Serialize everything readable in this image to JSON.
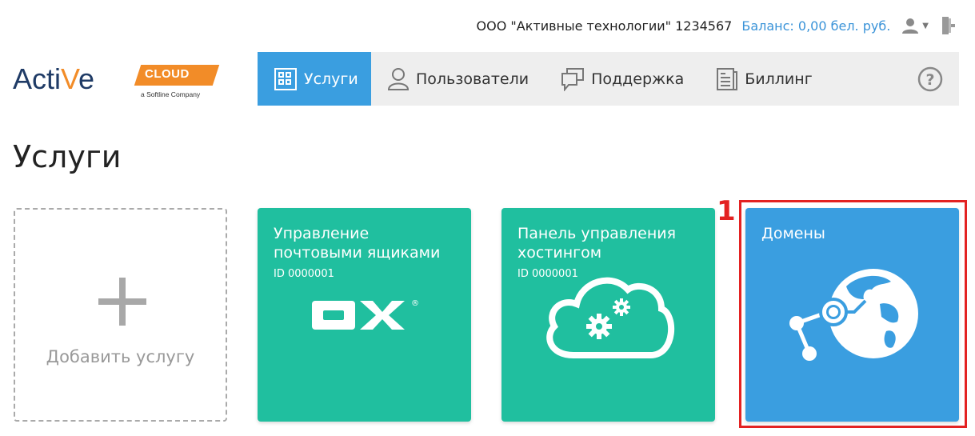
{
  "header": {
    "company": "ООО \"Активные технологии\" 1234567",
    "balance": "Баланс: 0,00 бел. руб.",
    "user_icon": "user-icon",
    "logout_icon": "logout-icon"
  },
  "logo": {
    "word": "ActiVe",
    "badge": "CLOUD",
    "subtitle": "a Softline Company"
  },
  "nav": {
    "items": [
      {
        "label": "Услуги",
        "icon": "services-grid-icon",
        "active": true
      },
      {
        "label": "Пользователи",
        "icon": "user-outline-icon",
        "active": false
      },
      {
        "label": "Поддержка",
        "icon": "chat-bubble-icon",
        "active": false
      },
      {
        "label": "Биллинг",
        "icon": "billing-document-icon",
        "active": false
      }
    ],
    "help_icon": "help-icon"
  },
  "page": {
    "title": "Услуги"
  },
  "cards": {
    "add": {
      "label": "Добавить услугу"
    },
    "mail": {
      "title": "Управление почтовыми ящиками",
      "id": "ID 0000001",
      "logo_text": "OX",
      "logo_mark": "®"
    },
    "hosting": {
      "title": "Панель управления хостингом",
      "id": "ID 0000001"
    },
    "domains": {
      "title": "Домены"
    }
  },
  "annotation": {
    "marker": "1"
  },
  "colors": {
    "accent_blue": "#3a9ee0",
    "card_green": "#20bf9f",
    "highlight_red": "#e32222",
    "logo_orange": "#f28c28",
    "logo_navy": "#1f3b66"
  }
}
